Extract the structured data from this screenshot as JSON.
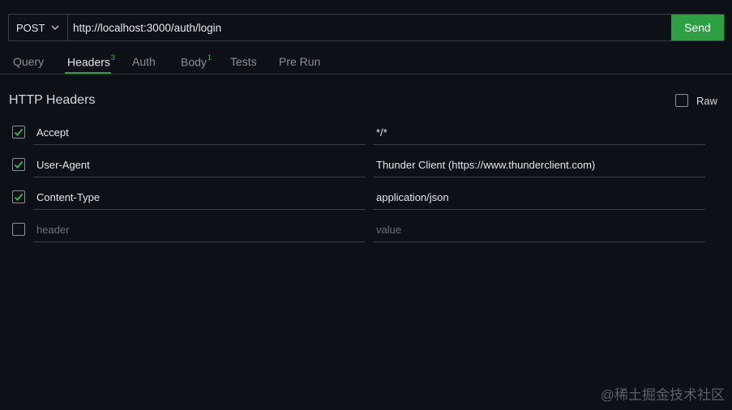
{
  "request": {
    "method": "POST",
    "url": "http://localhost:3000/auth/login",
    "send_label": "Send"
  },
  "tabs": [
    {
      "label": "Query",
      "badge": ""
    },
    {
      "label": "Headers",
      "badge": "3",
      "active": true
    },
    {
      "label": "Auth",
      "badge": ""
    },
    {
      "label": "Body",
      "badge": "1"
    },
    {
      "label": "Tests",
      "badge": ""
    },
    {
      "label": "Pre Run",
      "badge": ""
    }
  ],
  "section": {
    "title": "HTTP Headers",
    "raw_label": "Raw",
    "raw_checked": false
  },
  "headers": [
    {
      "checked": true,
      "key": "Accept",
      "value": "*/*"
    },
    {
      "checked": true,
      "key": "User-Agent",
      "value": "Thunder Client (https://www.thunderclient.com)"
    },
    {
      "checked": true,
      "key": "Content-Type",
      "value": "application/json"
    },
    {
      "checked": false,
      "key": "",
      "value": "",
      "key_placeholder": "header",
      "value_placeholder": "value"
    }
  ],
  "watermark": "@稀土掘金技术社区",
  "colors": {
    "accent": "#2ea043",
    "background": "#0d1117"
  }
}
